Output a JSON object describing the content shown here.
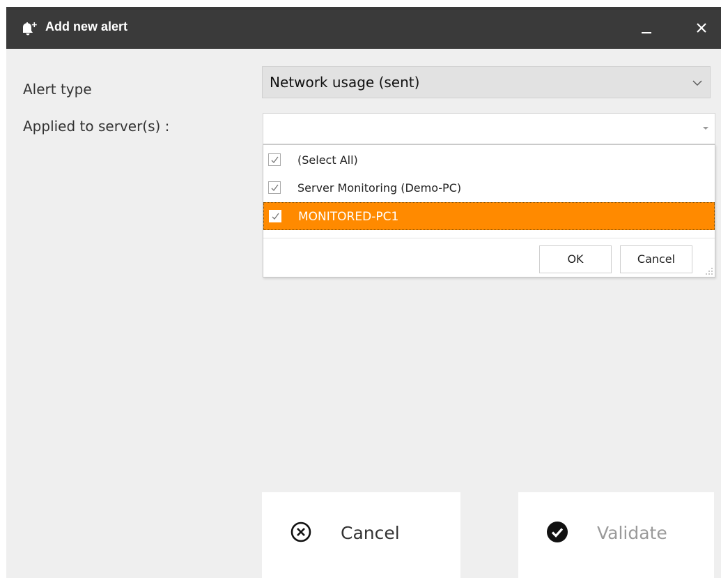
{
  "window": {
    "title": "Add new alert",
    "title_icon": "bell-plus-icon",
    "minimize_icon": "minimize-icon",
    "close_icon": "close-icon"
  },
  "form": {
    "alert_type_label": "Alert type",
    "alert_type_value": "Network usage (sent)",
    "applied_label": "Applied to server(s) :",
    "applied_value": ""
  },
  "dropdown": {
    "options": [
      {
        "label": "(Select All)",
        "checked": true,
        "selected": false
      },
      {
        "label": "Server Monitoring (Demo-PC)",
        "checked": true,
        "selected": false
      },
      {
        "label": "MONITORED-PC1",
        "checked": true,
        "selected": true
      }
    ],
    "ok_label": "OK",
    "cancel_label": "Cancel"
  },
  "actions": {
    "cancel_label": "Cancel",
    "cancel_icon": "circle-x-icon",
    "validate_label": "Validate",
    "validate_icon": "circle-check-icon"
  },
  "colors": {
    "titlebar": "#3a3a3a",
    "highlight": "#ff8a00",
    "window_bg": "#efefef"
  }
}
